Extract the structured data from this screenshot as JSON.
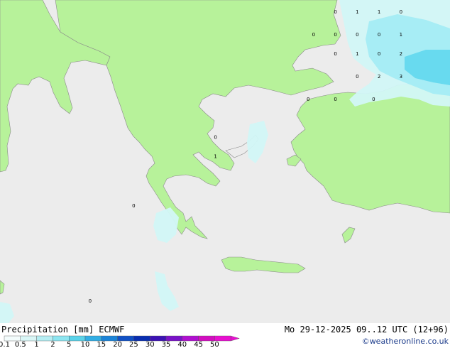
{
  "title": "Precipitation [mm]",
  "model": "ECMWF",
  "valid_time": "Mo 29-12-2025 09..12 UTC (12+96)",
  "credit": "©weatheronline.co.uk",
  "colors": {
    "sea": "#ececec",
    "land": "#b7f29a",
    "coast": "#8a8a8a",
    "light_precip": "#d2f7f7",
    "med_precip": "#a4ecf4",
    "heavy_precip": "#62d7ee"
  },
  "legend": {
    "ticks": [
      "0.1",
      "0.5",
      "1",
      "2",
      "5",
      "10",
      "15",
      "20",
      "25",
      "30",
      "35",
      "40",
      "45",
      "50"
    ],
    "colors": [
      "#f3fcfc",
      "#d9f6f6",
      "#b6eef3",
      "#8de5f0",
      "#5bd3ea",
      "#32aee4",
      "#1c84d8",
      "#1050c5",
      "#092eb0",
      "#3c12b4",
      "#7a12c8",
      "#b010d0",
      "#d20ec0",
      "#e80fd0"
    ]
  },
  "grid_values": [
    {
      "label": "0",
      "lat": 42.2,
      "lon": 28.3
    },
    {
      "label": "1",
      "lat": 42.2,
      "lon": 29.1
    },
    {
      "label": "1",
      "lat": 42.2,
      "lon": 29.9
    },
    {
      "label": "0",
      "lat": 42.2,
      "lon": 30.7
    },
    {
      "label": "0",
      "lat": 41.6,
      "lon": 27.5
    },
    {
      "label": "0",
      "lat": 41.6,
      "lon": 28.3
    },
    {
      "label": "0",
      "lat": 41.6,
      "lon": 29.1
    },
    {
      "label": "0",
      "lat": 41.6,
      "lon": 29.9
    },
    {
      "label": "1",
      "lat": 41.6,
      "lon": 30.7
    },
    {
      "label": "0",
      "lat": 41.1,
      "lon": 28.3
    },
    {
      "label": "1",
      "lat": 41.1,
      "lon": 29.1
    },
    {
      "label": "0",
      "lat": 41.1,
      "lon": 29.9
    },
    {
      "label": "2",
      "lat": 41.1,
      "lon": 30.7
    },
    {
      "label": "0",
      "lat": 40.5,
      "lon": 29.1
    },
    {
      "label": "2",
      "lat": 40.5,
      "lon": 29.9
    },
    {
      "label": "3",
      "lat": 40.5,
      "lon": 30.7
    },
    {
      "label": "0",
      "lat": 39.9,
      "lon": 27.3
    },
    {
      "label": "0",
      "lat": 39.9,
      "lon": 28.3
    },
    {
      "label": "0",
      "lat": 39.9,
      "lon": 29.7
    },
    {
      "label": "0",
      "lat": 38.9,
      "lon": 23.9
    },
    {
      "label": "1",
      "lat": 38.4,
      "lon": 23.9
    },
    {
      "label": "0",
      "lat": 37.1,
      "lon": 20.9
    },
    {
      "label": "0",
      "lat": 34.6,
      "lon": 19.3
    }
  ]
}
